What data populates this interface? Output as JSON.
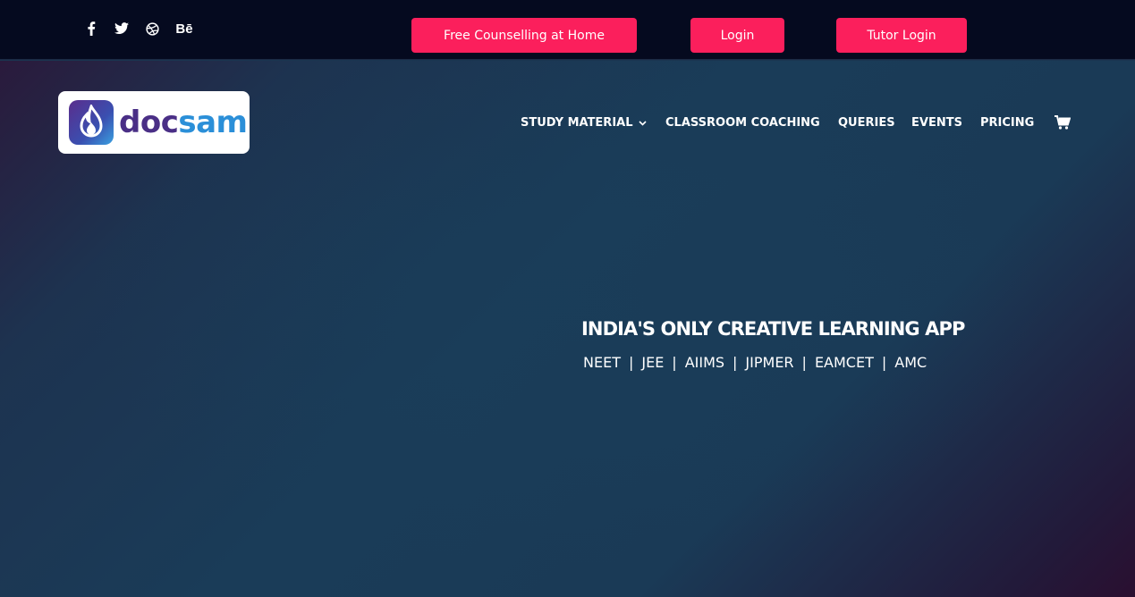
{
  "topbar": {
    "social": [
      {
        "icon": "facebook-icon"
      },
      {
        "icon": "twitter-icon"
      },
      {
        "icon": "dribbble-icon"
      },
      {
        "icon": "behance-icon",
        "label": "Bē"
      }
    ],
    "buttons": {
      "counselling": "Free Counselling at Home",
      "login": "Login",
      "tutor_login": "Tutor Login"
    },
    "button_color": "#fb1f5c",
    "background": "#050a1f"
  },
  "logo": {
    "part1": "doc",
    "part2": "sam"
  },
  "nav": {
    "study_material": "STUDY MATERIAL",
    "classroom_coaching": "CLASSROOM COACHING",
    "queries": "QUERIES",
    "events": "EVENTS",
    "pricing": "PRICING",
    "cart_icon": "cart-icon"
  },
  "hero": {
    "headline": "INDIA'S ONLY CREATIVE LEARNING APP",
    "exams": [
      "NEET",
      "JEE",
      "AIIMS",
      "JIPMER",
      "EAMCET",
      "AMC"
    ],
    "separator": "|"
  }
}
